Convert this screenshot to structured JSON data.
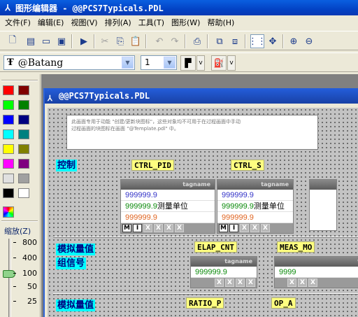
{
  "window": {
    "title": "图形编辑器 - @@PCS7Typicals.PDL"
  },
  "menu": [
    "文件(F)",
    "编辑(E)",
    "视图(V)",
    "排列(A)",
    "工具(T)",
    "图形(W)",
    "帮助(H)"
  ],
  "font_toolbar": {
    "font_name": "@Batang",
    "font_size": "1",
    "v1": "v",
    "v2": "v"
  },
  "palette": {
    "zoom_label": "缩放(Z)",
    "zoom_ticks": [
      "800",
      "400",
      "100",
      "50",
      "25"
    ],
    "colors": [
      "#ff0000",
      "#800000",
      "#00ff00",
      "#008000",
      "#0000ff",
      "#000080",
      "#00ffff",
      "#008080",
      "#ffff00",
      "#808000",
      "#ff00ff",
      "#800080",
      "#e0e0e0",
      "#a0a0a0",
      "#000000",
      "#ffffff"
    ]
  },
  "document": {
    "title": "@@PCS7Typicals.PDL",
    "note_line1": "此画面专用于动能 \"创建/更新块图标\"，这些对象均不可用于在过程画面中手动",
    "note_line2": "过程画面的块图标在画面 \"@Template.pdl\" 中。",
    "labels": {
      "control": "控制",
      "analog1": "模拟量值",
      "group_signal": "组信号",
      "analog2": "模拟量值",
      "ctrl_pid": "CTRL_PID",
      "ctrl_s": "CTRL_S",
      "elap_cnt": "ELAP_CNT",
      "meas_mon": "MEAS_MO",
      "ratio_p": "RATIO_P",
      "op_a": "OP_A"
    },
    "faceplate1": {
      "tag": "tagname",
      "pv": "999999.9",
      "sp": "999999.9",
      "unit": "测量单位",
      "out": "999999.9",
      "btn_m": "M",
      "btn_i": "I",
      "btn_x": "X"
    },
    "faceplate2": {
      "tag": "tagname",
      "pv": "999999.9",
      "sp": "999999.9",
      "unit": "测量单位",
      "out": "999999.9",
      "btn_m": "M",
      "btn_i": "I",
      "btn_x": "X"
    },
    "faceplate3": {
      "tag": "tagname",
      "sp": "999999.9",
      "btn_x": "X"
    },
    "faceplate4": {
      "tag": "t",
      "sp": "9999",
      "btn_x": "X"
    }
  }
}
